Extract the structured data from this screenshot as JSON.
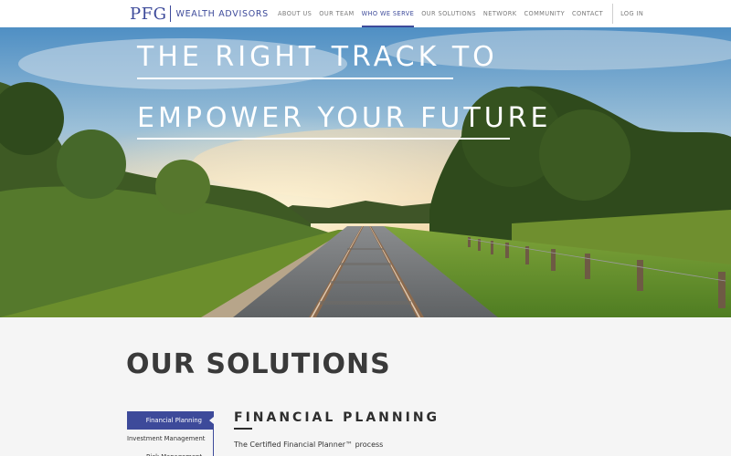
{
  "header": {
    "logo_mark": "PFG",
    "logo_text": "WEALTH ADVISORS",
    "nav": [
      {
        "label": "ABOUT US"
      },
      {
        "label": "OUR TEAM"
      },
      {
        "label": "WHO WE SERVE",
        "active": true
      },
      {
        "label": "OUR SOLUTIONS"
      },
      {
        "label": "NETWORK"
      },
      {
        "label": "COMMUNITY"
      },
      {
        "label": "CONTACT"
      }
    ],
    "login_label": "LOG IN"
  },
  "hero": {
    "line1": "THE RIGHT TRACK TO",
    "line2": "EMPOWER YOUR FUTURE"
  },
  "solutions": {
    "title": "OUR SOLUTIONS",
    "sidebar": [
      {
        "label": "Financial Planning",
        "active": true
      },
      {
        "label": "Investment Management"
      },
      {
        "label": "Risk Management"
      }
    ],
    "section_title": "FINANCIAL PLANNING",
    "section_body": "The Certified Financial Planner™ process"
  },
  "colors": {
    "brand": "#3d4a9a",
    "background": "#f5f5f5"
  }
}
